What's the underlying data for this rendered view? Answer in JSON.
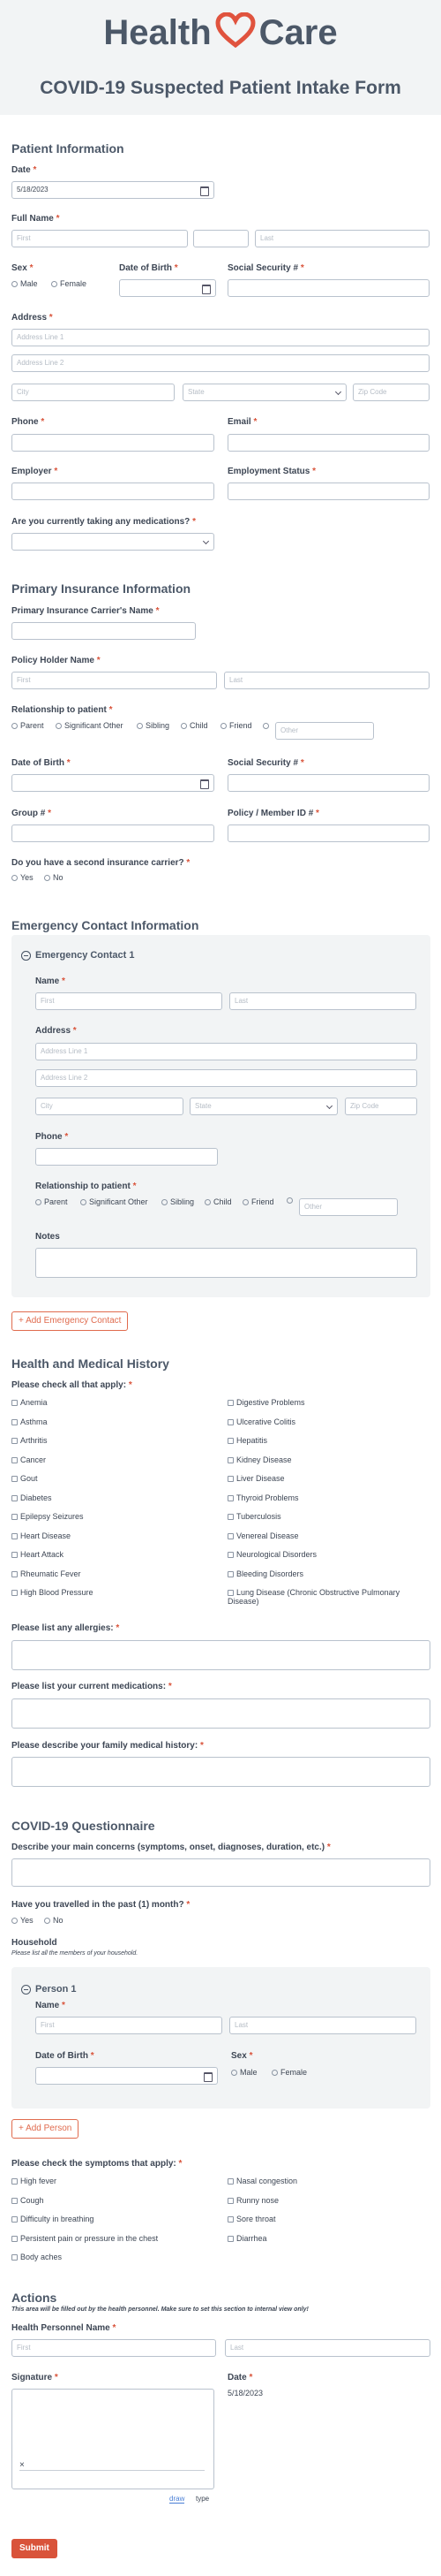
{
  "header": {
    "logo_left": "Health",
    "logo_right": "Care",
    "title": "COVID-19 Suspected Patient Intake Form"
  },
  "patient": {
    "heading": "Patient Information",
    "date_label": "Date",
    "date_value": "5/18/2023",
    "fullname_label": "Full Name",
    "first_ph": "First",
    "last_ph": "Last",
    "sex_label": "Sex",
    "male": "Male",
    "female": "Female",
    "dob_label": "Date of Birth",
    "ssn_label": "Social Security #",
    "address_label": "Address",
    "addr1_ph": "Address Line 1",
    "addr2_ph": "Address Line 2",
    "city_ph": "City",
    "state_ph": "State",
    "zip_ph": "Zip Code",
    "phone_label": "Phone",
    "email_label": "Email",
    "employer_label": "Employer",
    "empstatus_label": "Employment Status",
    "meds_label": "Are you currently taking any medications?"
  },
  "insurance": {
    "heading": "Primary Insurance Information",
    "carrier_label": "Primary Insurance Carrier's Name",
    "holder_label": "Policy Holder Name",
    "first_ph": "First",
    "last_ph": "Last",
    "relationship_label": "Relationship to patient",
    "relations": [
      "Parent",
      "Significant Other",
      "Sibling",
      "Child",
      "Friend"
    ],
    "other_ph": "Other",
    "dob_label": "Date of Birth",
    "ssn_label": "Social Security #",
    "group_label": "Group #",
    "policy_label": "Policy / Member ID #",
    "second_label": "Do you have a second insurance carrier?",
    "yes": "Yes",
    "no": "No"
  },
  "emergency": {
    "heading": "Emergency Contact Information",
    "contact_title": "Emergency Contact 1",
    "name_label": "Name",
    "first_ph": "First",
    "last_ph": "Last",
    "address_label": "Address",
    "addr1_ph": "Address Line 1",
    "addr2_ph": "Address Line 2",
    "city_ph": "City",
    "state_ph": "State",
    "zip_ph": "Zip Code",
    "phone_label": "Phone",
    "relationship_label": "Relationship to patient",
    "relations": [
      "Parent",
      "Significant Other",
      "Sibling",
      "Child",
      "Friend"
    ],
    "other_ph": "Other",
    "notes_label": "Notes",
    "add_button": "+ Add Emergency Contact"
  },
  "history": {
    "heading": "Health and Medical History",
    "check_label": "Please check all that apply:",
    "left": [
      "Anemia",
      "Asthma",
      "Arthritis",
      "Cancer",
      "Gout",
      "Diabetes",
      "Epilepsy Seizures",
      "Heart Disease",
      "Heart Attack",
      "Rheumatic Fever",
      "High Blood Pressure"
    ],
    "right": [
      "Digestive Problems",
      "Ulcerative Colitis",
      "Hepatitis",
      "Kidney Disease",
      "Liver Disease",
      "Thyroid Problems",
      "Tuberculosis",
      "Venereal Disease",
      "Neurological Disorders",
      "Bleeding Disorders",
      "Lung Disease (Chronic Obstructive Pulmonary Disease)"
    ],
    "allergies_label": "Please list any allergies:",
    "medications_label": "Please list your current medications:",
    "family_label": "Please describe your family medical history:"
  },
  "covid": {
    "heading": "COVID-19 Questionnaire",
    "concerns_label": "Describe your main concerns (symptoms, onset, diagnoses, duration, etc.)",
    "travel_label": "Have you travelled in the past (1) month?",
    "yes": "Yes",
    "no": "No",
    "household_label": "Household",
    "household_note": "Please list all the members of your household.",
    "person_title": "Person 1",
    "name_label": "Name",
    "first_ph": "First",
    "last_ph": "Last",
    "dob_label": "Date of Birth",
    "sex_label": "Sex",
    "male": "Male",
    "female": "Female",
    "add_person": "+ Add Person",
    "symptoms_label": "Please check the symptoms that apply:",
    "symptoms_left": [
      "High fever",
      "Cough",
      "Difficulty in breathing",
      "Persistent pain or pressure in the chest",
      "Body aches"
    ],
    "symptoms_right": [
      "Nasal congestion",
      "Runny nose",
      "Sore throat",
      "Diarrhea"
    ]
  },
  "actions": {
    "heading": "Actions",
    "note": "This area will be filled out by the health personnel. Make sure to set this section to internal view only!",
    "personnel_label": "Health Personnel Name",
    "first_ph": "First",
    "last_ph": "Last",
    "signature_label": "Signature",
    "sig_x": "×",
    "draw": "draw",
    "type": "type",
    "date_label": "Date",
    "date_value": "5/18/2023",
    "submit": "Submit"
  },
  "colors": {
    "accent": "#e06b4e",
    "required": "#d9533a",
    "header_bg": "#f2f4f5",
    "text": "#4c5868"
  }
}
